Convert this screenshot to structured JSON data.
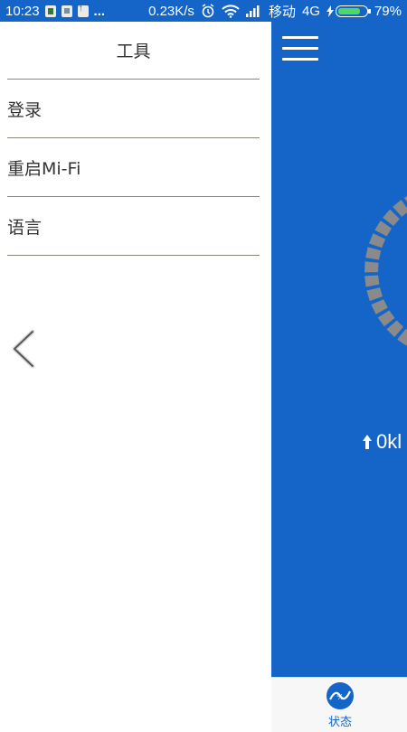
{
  "status_bar": {
    "time": "10:23",
    "more": "...",
    "net_speed": "0.23K/s",
    "carrier": "移动",
    "network": "4G",
    "battery": "79%",
    "battery_level": 0.79
  },
  "drawer": {
    "title": "工具",
    "items": [
      {
        "label": "登录"
      },
      {
        "label": "重启Mi-Fi"
      },
      {
        "label": "语言"
      }
    ]
  },
  "main": {
    "upload_speed": "0kl"
  },
  "bottom_tabs": [
    {
      "label": "状态"
    }
  ],
  "colors": {
    "primary": "#1565c8",
    "gauge": "#8a8a8a",
    "divider": "#8a8578"
  },
  "icons": [
    "menu-icon",
    "chevron-left-icon",
    "upload-arrow-icon",
    "status-icon",
    "alarm-icon",
    "wifi-icon",
    "signal-icon",
    "battery-icon"
  ]
}
